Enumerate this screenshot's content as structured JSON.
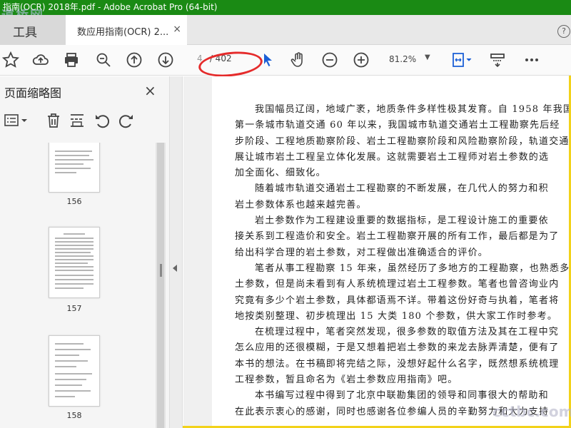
{
  "window": {
    "title": "指南(OCR) 2018年.pdf - Adobe Acrobat Pro (64-bit)"
  },
  "watermark": {
    "top": "道桥网",
    "bottom": "cctbc.com"
  },
  "tabs": {
    "tools_label": "工具",
    "document_label": "数应用指南(OCR) 2...",
    "close_glyph": "×"
  },
  "toolbar": {
    "page_current": "4",
    "page_total": "/ 402",
    "zoom": "81.2%",
    "icons": [
      "star-icon",
      "upload-icon",
      "print-icon",
      "zoom-search-icon",
      "prev-page-icon",
      "next-page-icon",
      "select-cursor-icon",
      "hand-icon",
      "zoom-out-icon",
      "zoom-in-icon",
      "fit-page-icon",
      "scroll-mode-icon",
      "more-icon"
    ],
    "accent": "#1a5fd6"
  },
  "sidebar": {
    "title": "页面缩略图",
    "close_glyph": "×",
    "tools": [
      "options-icon",
      "delete-icon",
      "insert-page-icon",
      "rotate-ccw-icon",
      "rotate-cw-icon"
    ],
    "thumbnails": [
      {
        "label": "156"
      },
      {
        "label": "157"
      },
      {
        "label": "158"
      }
    ]
  },
  "document": {
    "lines": [
      "我国幅员辽阔，地域广袤，地质条件多样性极其发育。自 1958 年我国",
      "第一条城市轨道交通 60 年以来，我国城市轨道交通岩土工程勘察先后经",
      "步阶段、工程地质勘察阶段、岩土工程勘察阶段和风险勘察阶段，轨道交通",
      "展让城市岩土工程呈立体化发展。这就需要岩土工程师对岩土参数的选",
      "加全面化、细致化。",
      "随着城市轨道交通岩土工程勘察的不断发展，在几代人的努力和积",
      "岩土参数体系也越来越完善。",
      "岩土参数作为工程建设重要的数据指标，是工程设计施工的重要依",
      "接关系到工程造价和安全。岩土工程勘察开展的所有工作，最后都是为了",
      "给出科学合理的岩土参数，对工程做出准确适合的评价。",
      "笔者从事工程勘察 15 年来，虽然经历了多地方的工程勘察，也熟悉多",
      "土参数，但是尚未看到有人系统梳理过岩土工程参数。笔者也曾咨询业内",
      "究竟有多少个岩土参数，具体都语焉不详。带着这份好奇与执着，笔者将",
      "地按类别整理、初步梳理出 15 大类 180 个参数，供大家工作时参考。",
      "在梳理过程中，笔者突然发现，很多参数的取值方法及其在工程中究",
      "怎么应用的还很模糊，于是又想着把岩土参数的来龙去脉弄清楚，便有了",
      "本书的想法。在书稿即将完结之际，没想好起什么名字，既然想系统梳理",
      "工程参数，暂且命名为《岩土参数应用指南》吧。",
      "本书编写过程中得到了北京中联勘集团的领导和同事很大的帮助和",
      "在此表示衷心的感谢，同时也感谢各位参编人员的辛勤努力和大力支持"
    ]
  }
}
